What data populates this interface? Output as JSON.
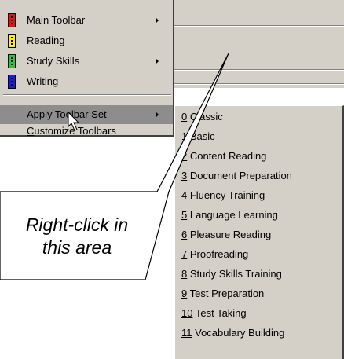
{
  "context_menu": {
    "items": [
      {
        "label": "Main Toolbar",
        "color": "#e8120c",
        "submenu": true,
        "icon": "toolbar-swatch-red-icon"
      },
      {
        "label": "Reading",
        "color": "#ffee00",
        "submenu": false,
        "icon": "toolbar-swatch-yellow-icon"
      },
      {
        "label": "Study Skills",
        "color": "#22c93a",
        "submenu": true,
        "icon": "toolbar-swatch-green-icon"
      },
      {
        "label": "Writing",
        "color": "#1b1bd8",
        "submenu": false,
        "icon": "toolbar-swatch-blue-icon"
      }
    ],
    "apply_toolbar_set": {
      "pre": "A",
      "key": "p",
      "post": "ply Toolbar Set"
    },
    "customize_toolbars": {
      "pre": "",
      "key": "C",
      "post": "ustomize Toolbars"
    }
  },
  "submenu": {
    "items": [
      {
        "key": "0",
        "rest": " Classic"
      },
      {
        "key": "1",
        "rest": " Basic"
      },
      {
        "key": "2",
        "rest": " Content Reading"
      },
      {
        "key": "3",
        "rest": " Document Preparation"
      },
      {
        "key": "4",
        "rest": " Fluency Training"
      },
      {
        "key": "5",
        "rest": " Language Learning"
      },
      {
        "key": "6",
        "rest": " Pleasure Reading"
      },
      {
        "key": "7",
        "rest": " Proofreading"
      },
      {
        "key": "8",
        "rest": " Study Skills Training"
      },
      {
        "key": "9",
        "rest": " Test Preparation"
      },
      {
        "key": "10",
        "rest": " Test Taking"
      },
      {
        "key": "11",
        "rest": " Vocabulary Building"
      }
    ]
  },
  "callout": {
    "line1": "Right-click in",
    "line2": "this area"
  },
  "colors": {
    "menu_bg": "#d4d0c8",
    "highlight": "#8d8d8d"
  }
}
